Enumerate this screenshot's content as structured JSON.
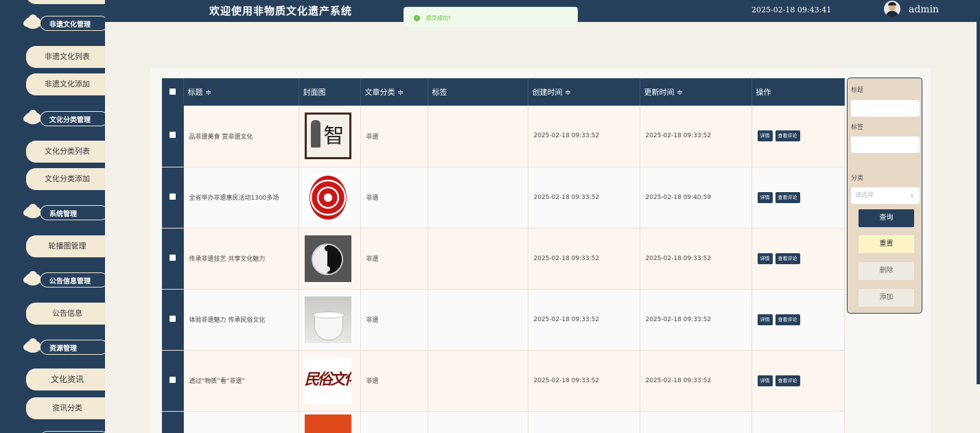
{
  "header": {
    "title": "欢迎使用非物质文化遗产系统",
    "datetime": "2025-02-18 09:43:41",
    "username": "admin"
  },
  "toast": {
    "message": "提交成功!"
  },
  "sidebar": {
    "groups": [
      {
        "label": "非遗文化管理",
        "items": [
          "非遗文化列表",
          "非遗文化添加"
        ]
      },
      {
        "label": "文化分类管理",
        "items": [
          "文化分类列表",
          "文化分类添加"
        ]
      },
      {
        "label": "系统管理",
        "items": [
          "轮播图管理"
        ]
      },
      {
        "label": "公告信息管理",
        "items": [
          "公告信息"
        ]
      },
      {
        "label": "资源管理",
        "items": [
          "文化资讯",
          "资讯分类"
        ]
      }
    ]
  },
  "table": {
    "columns": [
      "标题 ≑",
      "封面图",
      "文章分类 ≑",
      "标签",
      "创建时间 ≑",
      "更新时间 ≑",
      "操作"
    ],
    "action_detail": "详情",
    "action_comments": "查看评论",
    "rows": [
      {
        "title": "品非遗美食 赏非遗文化",
        "cover": "智",
        "category": "非遗",
        "tag": "",
        "created": "2025-02-18 09:33:52",
        "updated": "2025-02-18 09:33:52"
      },
      {
        "title": "全省举办非遗惠民活动1300多场",
        "cover": "",
        "category": "非遗",
        "tag": "",
        "created": "2025-02-18 09:33:52",
        "updated": "2025-02-18 09:40:59"
      },
      {
        "title": "传承非遗技艺 共享文化魅力",
        "cover": "",
        "category": "非遗",
        "tag": "",
        "created": "2025-02-18 09:33:52",
        "updated": "2025-02-18 09:33:52"
      },
      {
        "title": "体验非遗魅力 传承民俗文化",
        "cover": "",
        "category": "非遗",
        "tag": "",
        "created": "2025-02-18 09:33:52",
        "updated": "2025-02-18 09:33:52"
      },
      {
        "title": "透过“物质”看“非遗”",
        "cover": "民俗文化",
        "category": "非遗",
        "tag": "",
        "created": "2025-02-18 09:33:52",
        "updated": "2025-02-18 09:33:52"
      }
    ]
  },
  "search": {
    "title_label": "标题",
    "tag_label": "标签",
    "category_label": "分类",
    "category_placeholder": "请选择",
    "query_button": "查询",
    "reset_button": "重置",
    "delete_button": "删除",
    "add_button": "添加"
  },
  "colors": {
    "primary": "#26405c",
    "cream": "#f2ead5",
    "success": "#67c23a"
  }
}
